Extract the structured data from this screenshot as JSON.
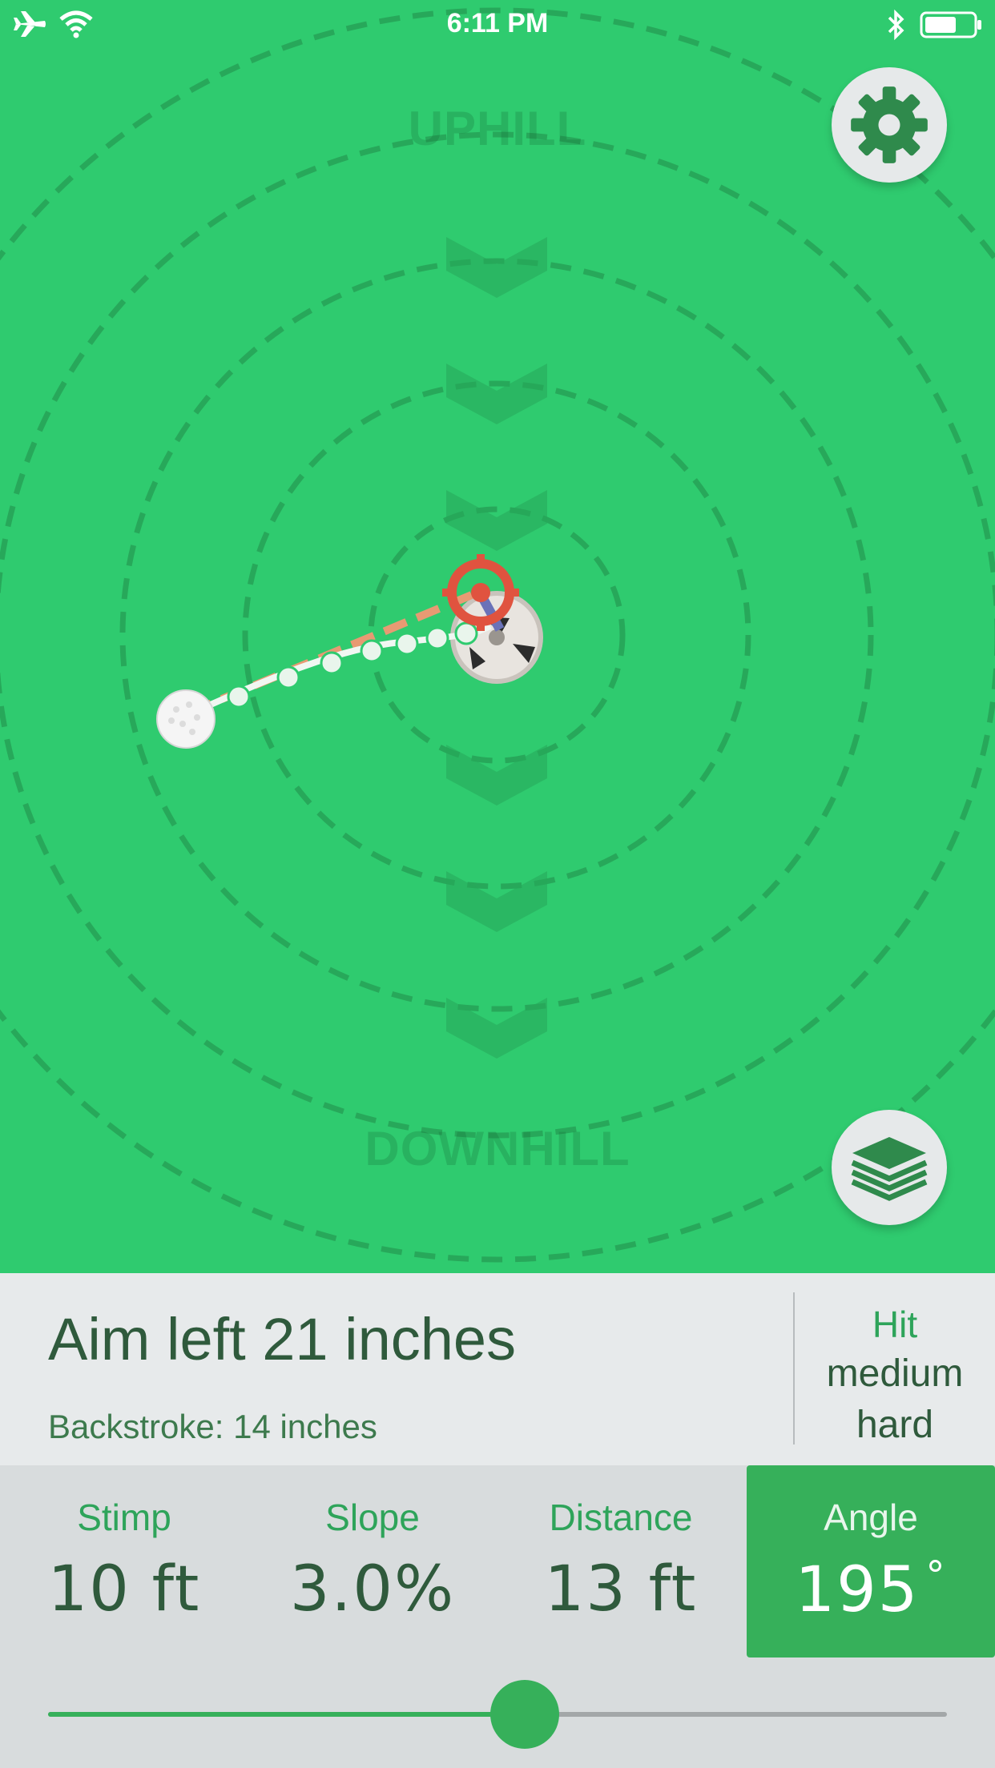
{
  "status_bar": {
    "time": "6:11 PM",
    "left_icons": [
      "airplane-icon",
      "wifi-icon"
    ],
    "right_icons": [
      "bluetooth-icon",
      "battery-icon"
    ]
  },
  "green": {
    "uphill_label": "UPHILL",
    "downhill_label": "DOWNHILL",
    "settings_icon": "gear-icon",
    "layers_icon": "layers-icon"
  },
  "result": {
    "aim": "Aim left 21 inches",
    "backstroke": "Backstroke: 14 inches",
    "hit_label": "Hit",
    "hit_strength_line1": "medium",
    "hit_strength_line2": "hard"
  },
  "stats": {
    "stimp_label": "Stimp",
    "stimp_value": "10 ft",
    "slope_label": "Slope",
    "slope_value": "3.0%",
    "distance_label": "Distance",
    "distance_value": "13 ft",
    "angle_label": "Angle",
    "angle_value": "195",
    "angle_unit": "°"
  },
  "slider": {
    "value_fraction": 0.53
  },
  "colors": {
    "green": "#2fcb6f",
    "accent": "#36b05a",
    "target_red": "#e0533f",
    "text_dark": "#2f5a3c"
  }
}
